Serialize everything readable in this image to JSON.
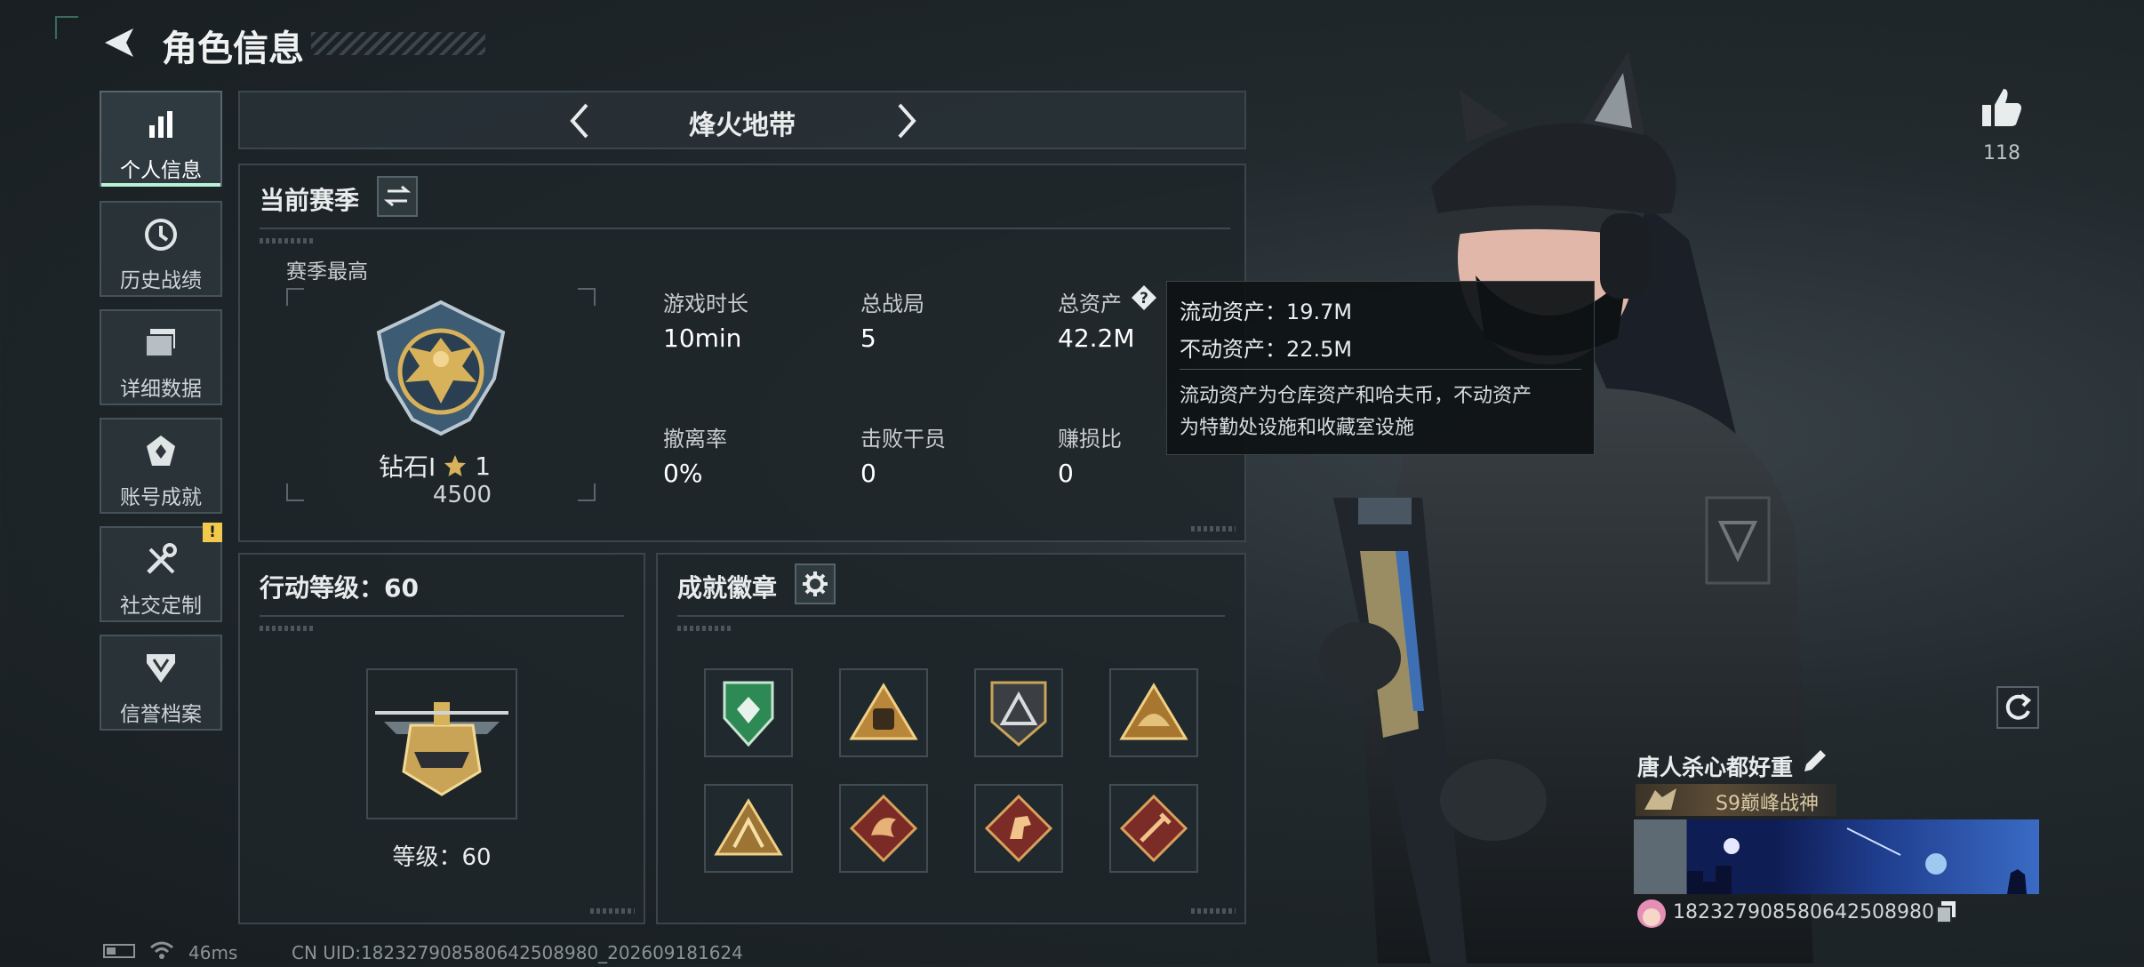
{
  "header": {
    "title": "角色信息"
  },
  "nav": [
    {
      "label": "个人信息",
      "icon": "bar-chart-icon"
    },
    {
      "label": "历史战绩",
      "icon": "clock-icon"
    },
    {
      "label": "详细数据",
      "icon": "folder-icon"
    },
    {
      "label": "账号成就",
      "icon": "achievement-icon"
    },
    {
      "label": "社交定制",
      "icon": "tools-icon",
      "alert": "!"
    },
    {
      "label": "信誉档案",
      "icon": "credit-icon"
    }
  ],
  "mode": {
    "title": "烽火地带"
  },
  "season": {
    "title": "当前赛季",
    "best_label": "赛季最高",
    "rank_name": "钻石Ⅰ",
    "rank_stars": "1",
    "rank_score": "4500",
    "stats": [
      {
        "label": "游戏时长",
        "value": "10min"
      },
      {
        "label": "总战局",
        "value": "5"
      },
      {
        "label": "总资产",
        "value": "42.2M"
      },
      {
        "label": "撤离率",
        "value": "0%"
      },
      {
        "label": "击败干员",
        "value": "0"
      },
      {
        "label": "赚损比",
        "value": "0"
      }
    ]
  },
  "tooltip": {
    "line1": "流动资产：19.7M",
    "line2": "不动资产：22.5M",
    "desc1": "流动资产为仓库资产和哈夫币，不动资产",
    "desc2": "为特勤处设施和收藏室设施"
  },
  "action_level": {
    "title": "行动等级：60",
    "level_text": "等级：60"
  },
  "achievements": {
    "title": "成就徽章",
    "badges": [
      "shield-badge-icon",
      "bag-badge-icon",
      "triangle-badge-icon",
      "helmet-badge-icon",
      "tent-badge-icon",
      "dragon-badge-icon",
      "horse-badge-icon",
      "sword-badge-icon"
    ]
  },
  "likes": {
    "count": "118"
  },
  "profile": {
    "name": "唐人杀心都好重",
    "title_badge": "S9巅峰战神",
    "uid": "18232790858064250898​0"
  },
  "status": {
    "ping": "46ms",
    "cn_uid": "CN UID:18232790858064250898​0_202609181624"
  },
  "colors": {
    "accent": "#b8f3d6",
    "gold": "#d8b25a",
    "alert": "#f2c94c"
  }
}
